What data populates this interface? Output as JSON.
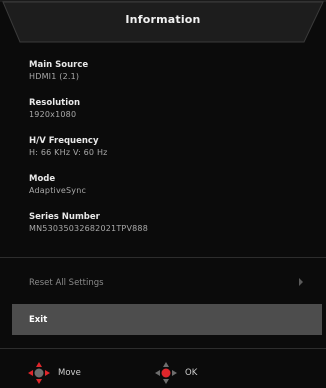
{
  "header": {
    "title": "Information"
  },
  "info": [
    {
      "label": "Main Source",
      "value": "HDMI1 (2.1)"
    },
    {
      "label": "Resolution",
      "value": "1920x1080"
    },
    {
      "label": "H/V Frequency",
      "value": "H: 66 KHz V: 60 Hz"
    },
    {
      "label": "Mode",
      "value": "AdaptiveSync"
    },
    {
      "label": "Series Number",
      "value": "MN53035032682021TPV888"
    }
  ],
  "menu": {
    "reset_label": "Reset All Settings",
    "exit_label": "Exit"
  },
  "footer": {
    "move_label": "Move",
    "ok_label": "OK"
  },
  "colors": {
    "background": "#0b0b0b",
    "selected_row": "#4d4d4d",
    "accent_red": "#e0262b"
  },
  "icons": {
    "move": "dpad-move-icon",
    "ok": "dpad-ok-icon",
    "submenu": "chevron-right-icon"
  }
}
